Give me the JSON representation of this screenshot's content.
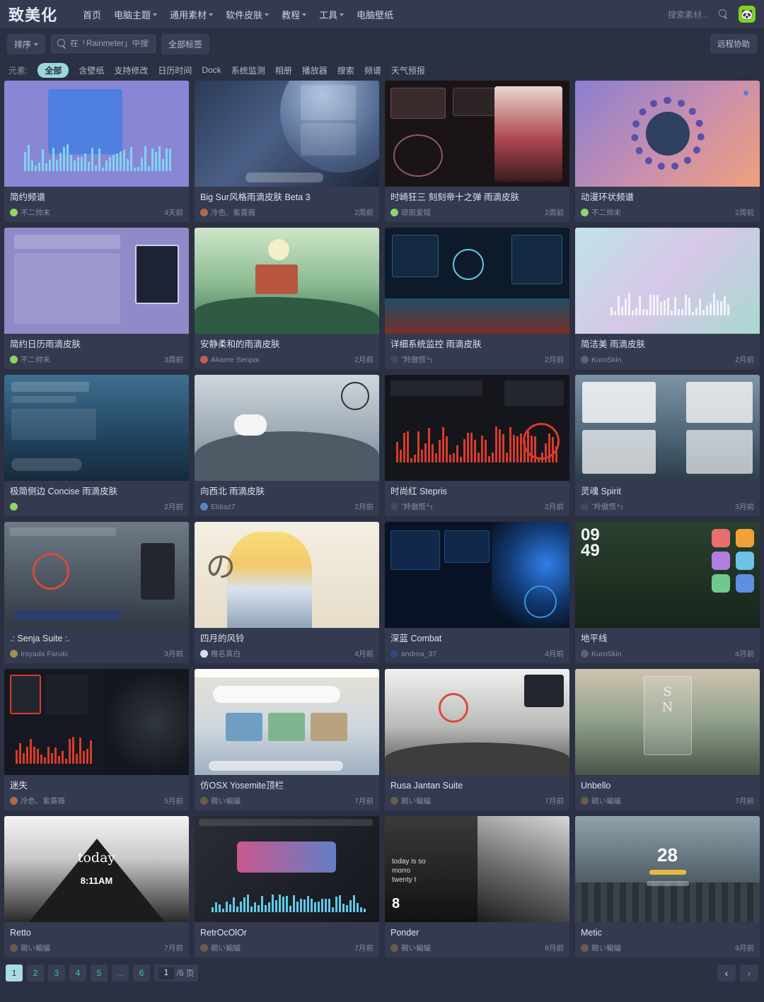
{
  "header": {
    "logo": "致美化",
    "nav": [
      {
        "label": "首页",
        "has_caret": false
      },
      {
        "label": "电脑主题",
        "has_caret": true
      },
      {
        "label": "通用素材",
        "has_caret": true
      },
      {
        "label": "软件皮肤",
        "has_caret": true
      },
      {
        "label": "教程",
        "has_caret": true
      },
      {
        "label": "工具",
        "has_caret": true
      },
      {
        "label": "电脑壁纸",
        "has_caret": false
      }
    ],
    "search_placeholder": "搜索素材...",
    "search_icon": "search-icon",
    "avatar_glyph": "🐼"
  },
  "filterbar": {
    "sort_label": "排序",
    "search_value": "",
    "search_placeholder": "在「Rainmeter」中搜索",
    "all_tags_label": "全部标签",
    "remote_label": "远程协助"
  },
  "tagrow": {
    "label": "元素:",
    "tags": [
      {
        "label": "全部",
        "active": true
      },
      {
        "label": "含壁纸",
        "active": false
      },
      {
        "label": "支持修改",
        "active": false
      },
      {
        "label": "日历时间",
        "active": false
      },
      {
        "label": "Dock",
        "active": false
      },
      {
        "label": "系统监测",
        "active": false
      },
      {
        "label": "相册",
        "active": false
      },
      {
        "label": "播放器",
        "active": false
      },
      {
        "label": "搜索",
        "active": false
      },
      {
        "label": "频谱",
        "active": false
      },
      {
        "label": "天气预报",
        "active": false
      }
    ]
  },
  "cards": [
    {
      "title": "简约频谱",
      "author": "不二帅末",
      "time": "4天前",
      "avatar_color": "#8fd46a",
      "art": "spectrum-purple"
    },
    {
      "title": "Big Sur风格雨滴皮肤 Beta 3",
      "author": "冷色、紫蔷薇",
      "time": "2周前",
      "avatar_color": "#b06a4a",
      "art": "bigsur"
    },
    {
      "title": "时崎狂三 刻刻帝十之弹 雨滴皮肤",
      "author": "琼丽爱瑶",
      "time": "2周前",
      "avatar_color": "#8fd46a",
      "art": "kurumi"
    },
    {
      "title": "动漫环状频谱",
      "author": "不二帅末",
      "time": "2周前",
      "avatar_color": "#8fd46a",
      "art": "ring-spectrum"
    },
    {
      "title": "简约日历雨滴皮肤",
      "author": "不二帅末",
      "time": "3周前",
      "avatar_color": "#8fd46a",
      "art": "calendar"
    },
    {
      "title": "安静柔和的雨滴皮肤",
      "author": "Akame Senpai",
      "time": "2月前",
      "avatar_color": "#c2604f",
      "art": "sunday"
    },
    {
      "title": "详细系统监控 雨滴皮肤",
      "author": "ˇ羚傲慌ㄣ",
      "time": "2月前",
      "avatar_color": "#3e4a5e",
      "art": "sysmon"
    },
    {
      "title": "简洁美 雨滴皮肤",
      "author": "KuroSkin",
      "time": "2月前",
      "avatar_color": "#5b6273",
      "art": "clean"
    },
    {
      "title": "极简侧边 Concise 雨滴皮肤",
      "author": "",
      "time": "2月前",
      "avatar_color": "#8fd46a",
      "art": "concise"
    },
    {
      "title": "向西北 雨滴皮肤",
      "author": "Eldiaz7",
      "time": "2月前",
      "avatar_color": "#5b84c0",
      "art": "northwest"
    },
    {
      "title": "时尚红 Stepris",
      "author": "ˇ羚傲慌ㄣ",
      "time": "2月前",
      "avatar_color": "#3e4a5e",
      "art": "stepris"
    },
    {
      "title": "灵魂 Spirit",
      "author": "ˇ羚傲慌ㄣ",
      "time": "3月前",
      "avatar_color": "#3e4a5e",
      "art": "spirit"
    },
    {
      "title": ".: Senja Suite :.",
      "author": "Irsyada Faruki",
      "time": "3月前",
      "avatar_color": "#a98b55",
      "art": "senja"
    },
    {
      "title": "四月的风铃",
      "author": "椎名真白",
      "time": "4月前",
      "avatar_color": "#d8dde8",
      "art": "april"
    },
    {
      "title": "深蓝 Combat",
      "author": "andrea_37",
      "time": "4月前",
      "avatar_color": "#2f4a7a",
      "art": "combat"
    },
    {
      "title": "地平线",
      "author": "KuroSkin",
      "time": "4月前",
      "avatar_color": "#5b6273",
      "art": "horizon"
    },
    {
      "title": "迷失",
      "author": "冷色、紫蔷薇",
      "time": "5月前",
      "avatar_color": "#b06a4a",
      "art": "lost"
    },
    {
      "title": "仿OSX Yosemite顶栏",
      "author": "親い蝙蝠",
      "time": "7月前",
      "avatar_color": "#6b5b4a",
      "art": "yosemite"
    },
    {
      "title": "Rusa Jantan Suite",
      "author": "親い蝙蝠",
      "time": "7月前",
      "avatar_color": "#6b5b4a",
      "art": "rusa"
    },
    {
      "title": "Unbello",
      "author": "親い蝙蝠",
      "time": "7月前",
      "avatar_color": "#6b5b4a",
      "art": "unbello"
    },
    {
      "title": "Retto",
      "author": "親い蝙蝠",
      "time": "7月前",
      "avatar_color": "#6b5b4a",
      "art": "retto"
    },
    {
      "title": "RetrOcOlOr",
      "author": "親い蝙蝠",
      "time": "7月前",
      "avatar_color": "#6b5b4a",
      "art": "retrocolor"
    },
    {
      "title": "Ponder",
      "author": "親い蝙蝠",
      "time": "8月前",
      "avatar_color": "#6b5b4a",
      "art": "ponder"
    },
    {
      "title": "Metic",
      "author": "親い蝙蝠",
      "time": "9月前",
      "avatar_color": "#6b5b4a",
      "art": "metic"
    }
  ],
  "pagination": {
    "pages": [
      "1",
      "2",
      "3",
      "4",
      "5",
      "...",
      "6"
    ],
    "active_page": "1",
    "jump_value": "1",
    "total_label": "/6 页",
    "prev_glyph": "‹",
    "next_glyph": "›"
  },
  "colors": {
    "bg": "#2b3043",
    "panel": "#343a4f",
    "accent_green": "#3ec99a",
    "accent_cyan": "#9ad6dd"
  }
}
